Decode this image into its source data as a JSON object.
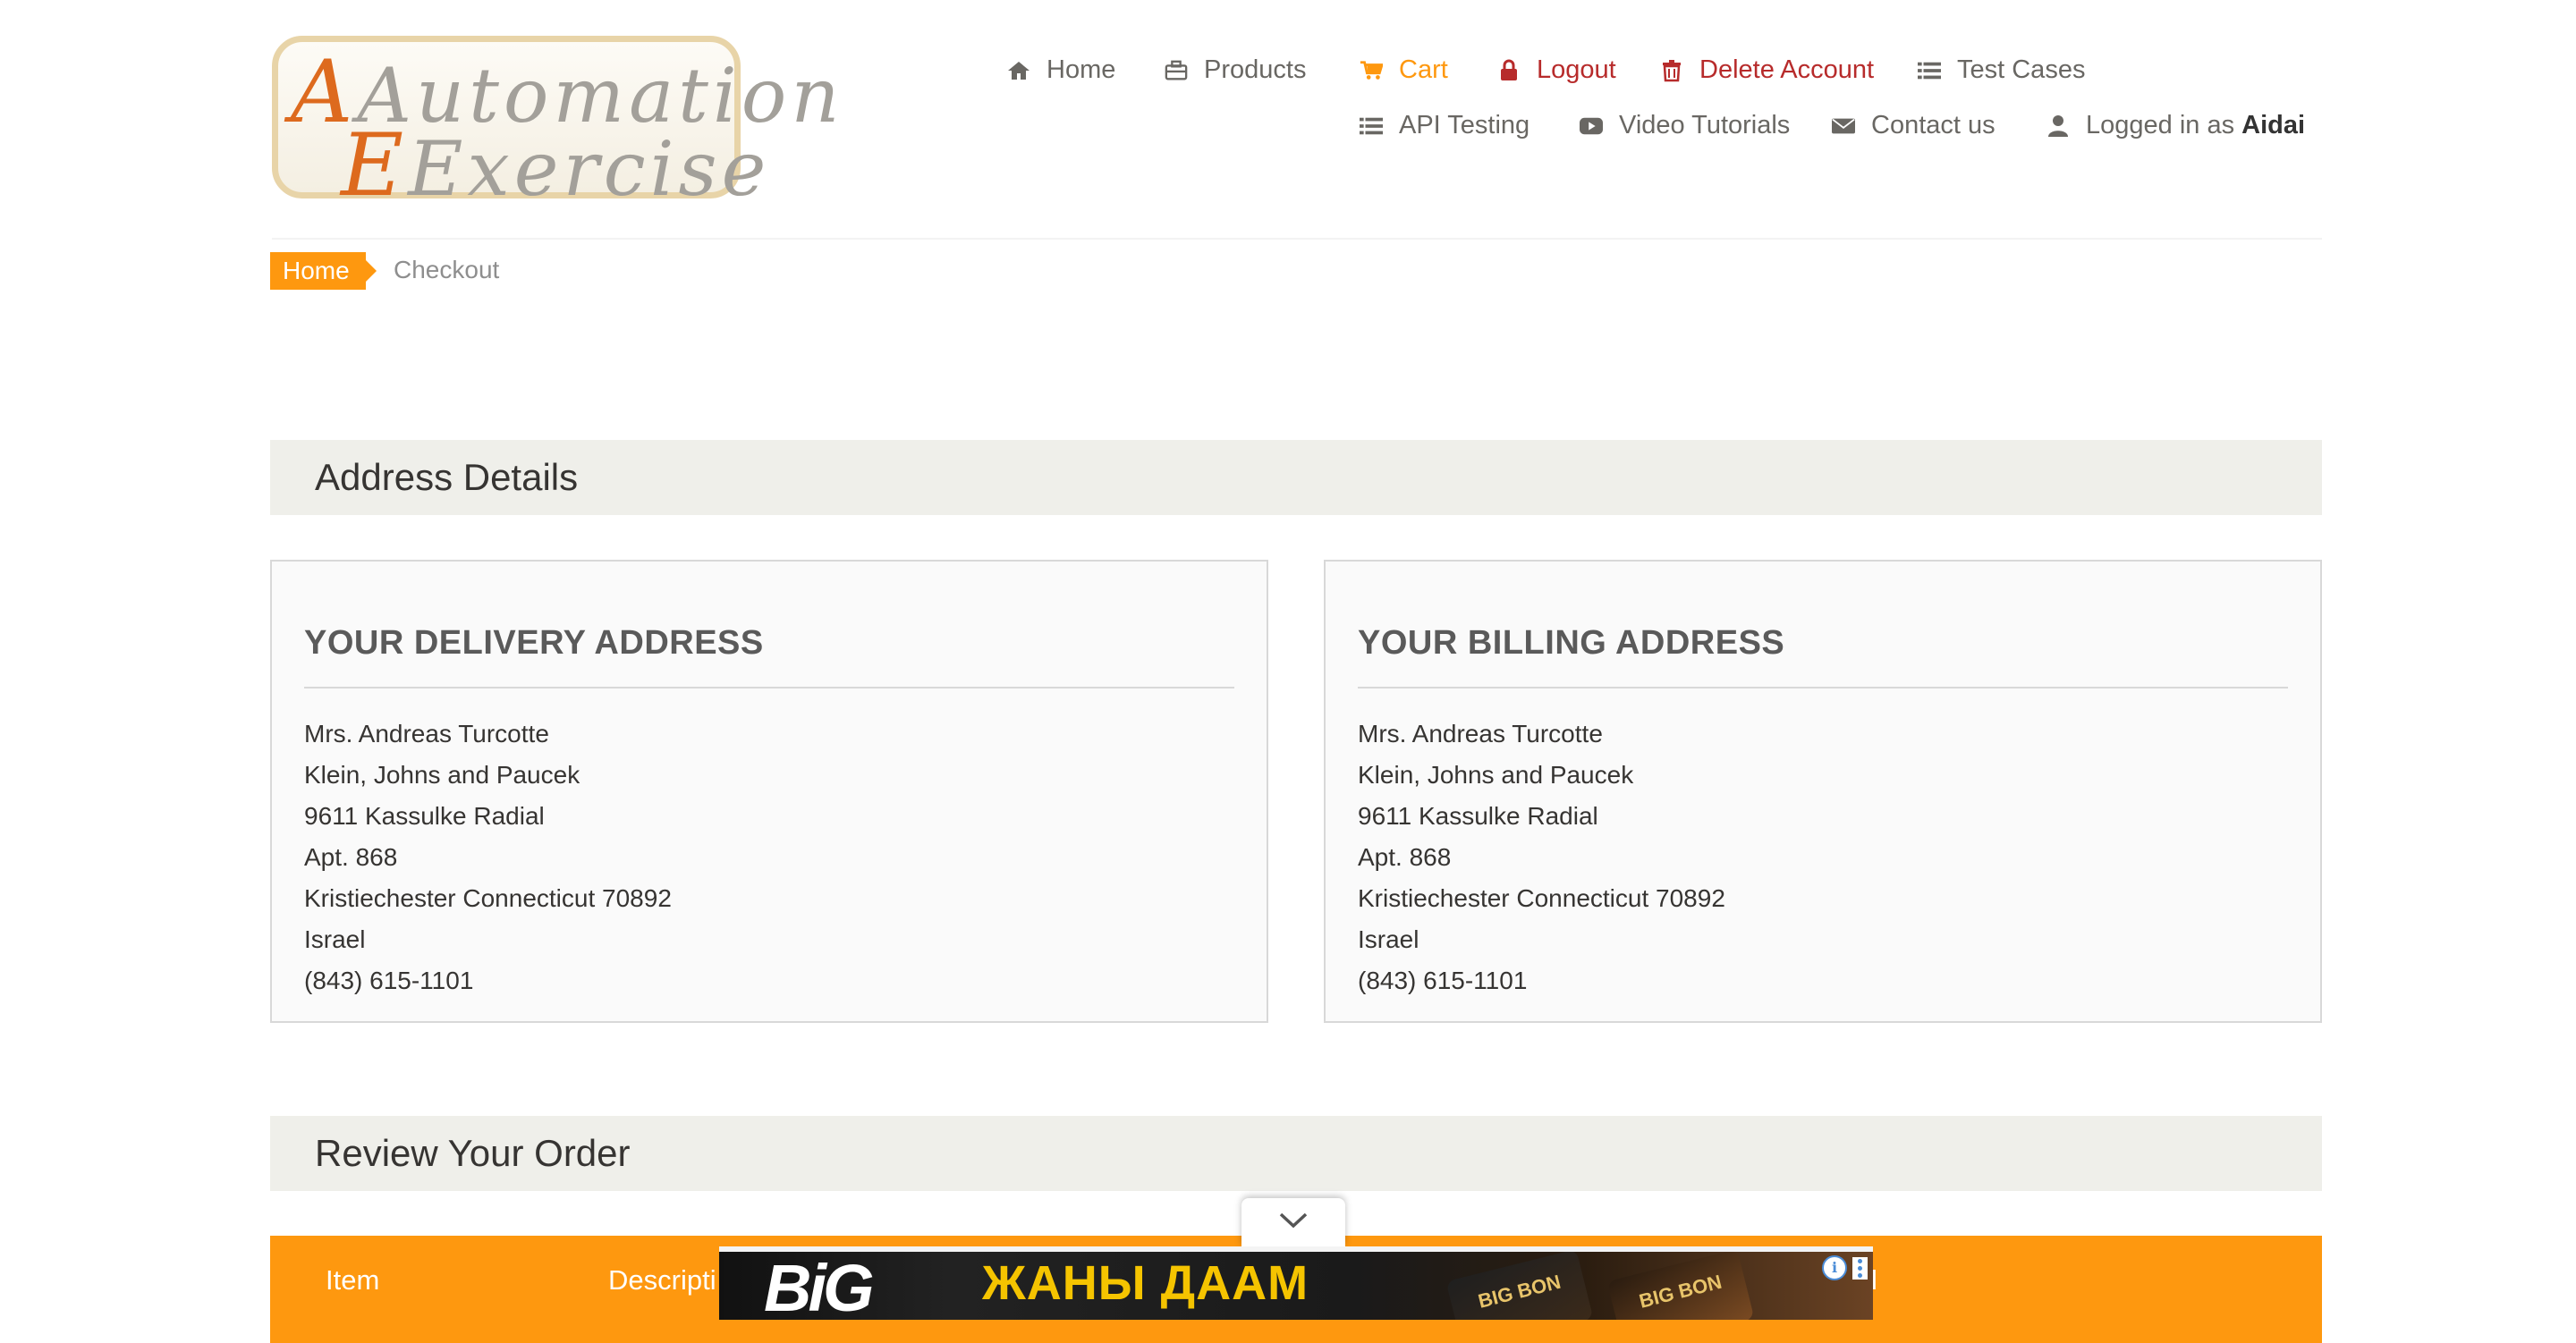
{
  "logo": {
    "line1": "Automation",
    "line2": "Exercise"
  },
  "nav": {
    "home": {
      "label": "Home",
      "icon": "home-icon"
    },
    "products": {
      "label": "Products",
      "icon": "briefcase-icon"
    },
    "cart": {
      "label": "Cart",
      "icon": "shopping-cart-icon",
      "color": "#fe980f"
    },
    "logout": {
      "label": "Logout",
      "icon": "lock-icon",
      "color": "#b72b2b"
    },
    "delete_account": {
      "label": "Delete Account",
      "icon": "trash-icon",
      "color": "#b72b2b"
    },
    "test_cases": {
      "label": "Test Cases",
      "icon": "list-icon"
    },
    "api_testing": {
      "label": "API Testing",
      "icon": "list-icon"
    },
    "video_tutorials": {
      "label": "Video Tutorials",
      "icon": "youtube-play-icon"
    },
    "contact_us": {
      "label": "Contact us",
      "icon": "envelope-icon"
    },
    "logged_in": {
      "prefix": "Logged in as",
      "username": "Aidai",
      "icon": "user-icon"
    }
  },
  "breadcrumb": {
    "home": "Home",
    "current": "Checkout"
  },
  "address_details": {
    "heading": "Address Details",
    "delivery": {
      "title": "YOUR DELIVERY ADDRESS",
      "name": "Mrs. Andreas Turcotte",
      "company": "Klein, Johns and Paucek",
      "address1": "9611 Kassulke Radial",
      "address2": "Apt. 868",
      "city_state_zip": "Kristiechester Connecticut 70892",
      "country": "Israel",
      "phone": "(843) 615-1101"
    },
    "billing": {
      "title": "YOUR BILLING ADDRESS",
      "name": "Mrs. Andreas Turcotte",
      "company": "Klein, Johns and Paucek",
      "address1": "9611 Kassulke Radial",
      "address2": "Apt. 868",
      "city_state_zip": "Kristiechester Connecticut 70892",
      "country": "Israel",
      "phone": "(843) 615-1101"
    }
  },
  "review_order": {
    "heading": "Review Your Order",
    "columns": {
      "item": "Item",
      "description": "Descripti",
      "total_fragment": "l"
    }
  },
  "ad": {
    "brand": "BiG",
    "headline": "ЖАНЫ ДААМ",
    "pack_label": "BIG BON",
    "info_icon": "info-icon",
    "menu_icon": "kebab-menu-icon",
    "toggle_icon": "chevron-down-icon"
  },
  "colors": {
    "accent": "#fe980f",
    "danger": "#b72b2b",
    "section_bg": "#efefea"
  }
}
